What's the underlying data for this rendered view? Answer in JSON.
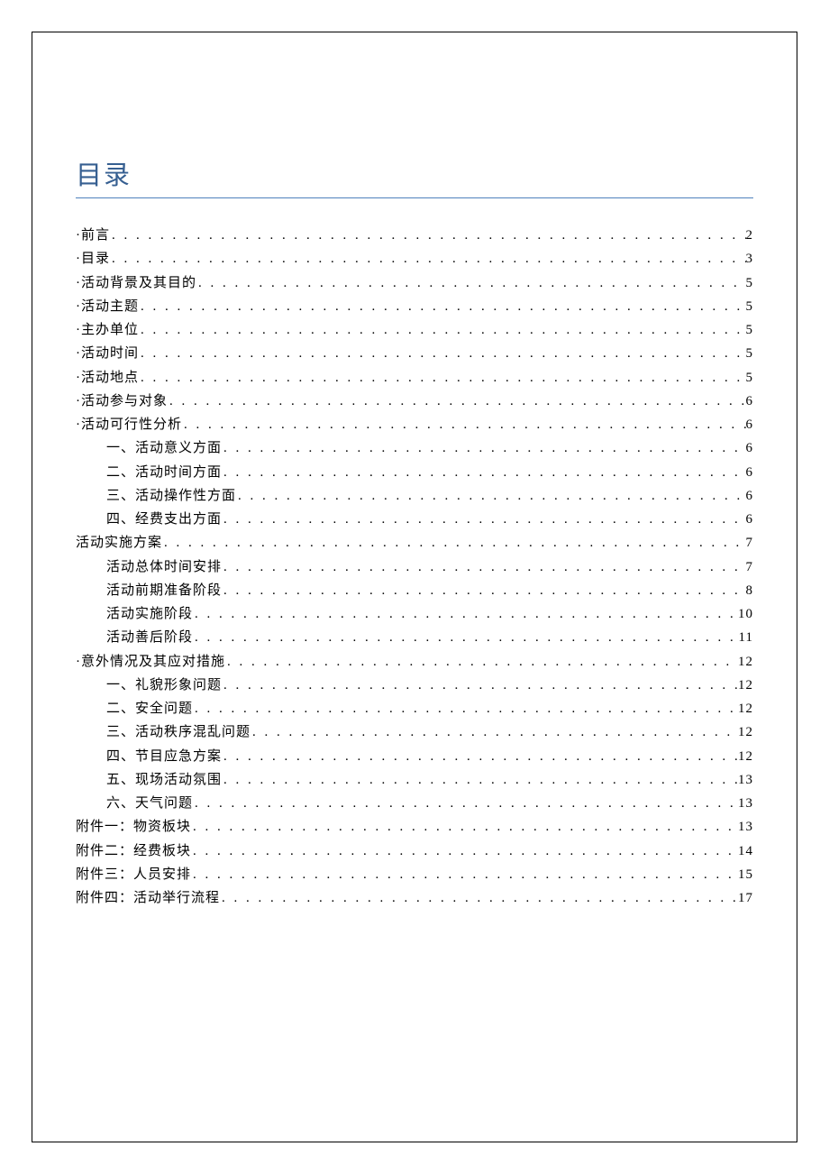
{
  "title": "目录",
  "toc": [
    {
      "label": "·前言",
      "page": "2",
      "indent": 0
    },
    {
      "label": "·目录",
      "page": "3",
      "indent": 0
    },
    {
      "label": "·活动背景及其目的",
      "page": "5",
      "indent": 0
    },
    {
      "label": "·活动主题",
      "page": "5",
      "indent": 0
    },
    {
      "label": "·主办单位",
      "page": "5",
      "indent": 0
    },
    {
      "label": "·活动时间",
      "page": "5",
      "indent": 0
    },
    {
      "label": "·活动地点",
      "page": "5",
      "indent": 0
    },
    {
      "label": "·活动参与对象",
      "page": "6",
      "indent": 0
    },
    {
      "label": "·活动可行性分析",
      "page": "6",
      "indent": 0
    },
    {
      "label": "一、活动意义方面",
      "page": "6",
      "indent": 1
    },
    {
      "label": "二、活动时间方面",
      "page": "6",
      "indent": 1
    },
    {
      "label": "三、活动操作性方面",
      "page": "6",
      "indent": 1
    },
    {
      "label": "四、经费支出方面",
      "page": "6",
      "indent": 1
    },
    {
      "label": "活动实施方案",
      "page": "7",
      "indent": 0,
      "noBullet": true
    },
    {
      "label": "活动总体时间安排",
      "page": "7",
      "indent": 1
    },
    {
      "label": "活动前期准备阶段",
      "page": "8",
      "indent": 1
    },
    {
      "label": "活动实施阶段",
      "page": "10",
      "indent": 1
    },
    {
      "label": "活动善后阶段",
      "page": "11",
      "indent": 1
    },
    {
      "label": "·意外情况及其应对措施",
      "page": "12",
      "indent": 0
    },
    {
      "label": "一、礼貌形象问题",
      "page": "12",
      "indent": 1
    },
    {
      "label": "二、安全问题",
      "page": "12",
      "indent": 1
    },
    {
      "label": "三、活动秩序混乱问题",
      "page": "12",
      "indent": 1
    },
    {
      "label": "四、节目应急方案",
      "page": "12",
      "indent": 1
    },
    {
      "label": "五、现场活动氛围",
      "page": "13",
      "indent": 1
    },
    {
      "label": "六、天气问题",
      "page": "13",
      "indent": 1
    },
    {
      "label": "附件一：物资板块",
      "page": "13",
      "indent": 0,
      "noBullet": true
    },
    {
      "label": "附件二：经费板块",
      "page": "14",
      "indent": 0,
      "noBullet": true
    },
    {
      "label": "附件三：人员安排",
      "page": "15",
      "indent": 0,
      "noBullet": true
    },
    {
      "label": "附件四：活动举行流程",
      "page": "17",
      "indent": 0,
      "noBullet": true
    }
  ]
}
